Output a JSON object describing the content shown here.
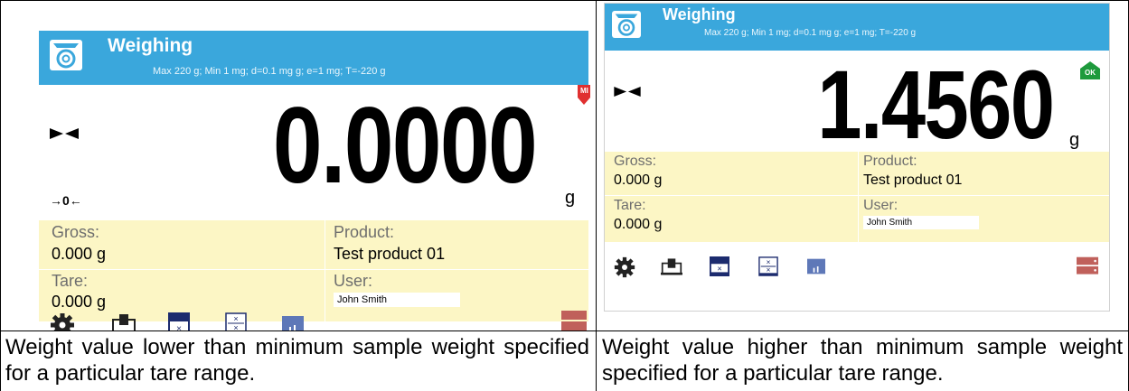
{
  "left_screen": {
    "title": "Weighing",
    "subtitle": "Max 220 g; Min 1 mg; d=0.1 mg g; e=1 mg; T=-220 g",
    "weight": "0.0000",
    "unit": "g",
    "zero_indicator": "→0←",
    "status_badge": "MI",
    "gross_label": "Gross:",
    "gross_value": "0.000 g",
    "product_label": "Product:",
    "product_value": "Test product 01",
    "tare_label": "Tare:",
    "tare_value": "0.000 g",
    "user_label": "User:",
    "user_value": "John Smith",
    "badge_color": "#e03030"
  },
  "right_screen": {
    "title": "Weighing",
    "subtitle": "Max 220 g; Min 1 mg; d=0.1 mg g; e=1 mg; T=-220 g",
    "weight": "1.4560",
    "unit": "g",
    "status_badge": "OK",
    "gross_label": "Gross:",
    "gross_value": "0.000 g",
    "product_label": "Product:",
    "product_value": "Test product 01",
    "tare_label": "Tare:",
    "tare_value": "0.000 g",
    "user_label": "User:",
    "user_value": "John Smith",
    "badge_color": "#1e9a3c"
  },
  "captions": {
    "left": "Weight value lower than minimum sample weight specified for a particular tare range.",
    "right": "Weight value higher than minimum sample weight specified for a particular tare range."
  },
  "colors": {
    "header": "#3aa7dc",
    "info_background": "#fcf6c5"
  }
}
